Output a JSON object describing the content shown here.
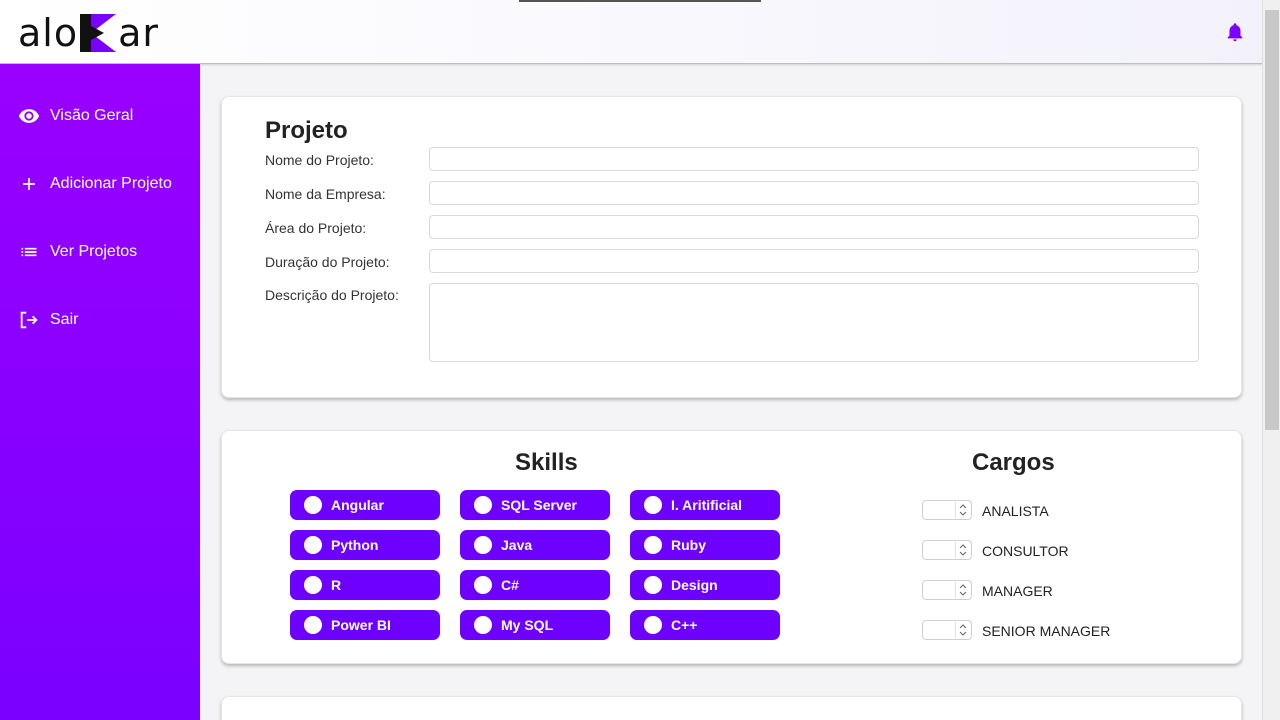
{
  "brand": {
    "logo_text_left": "alo",
    "logo_text_right": "ar"
  },
  "sidebar": {
    "items": [
      {
        "label": "Visão Geral",
        "icon": "eye-icon"
      },
      {
        "label": "Adicionar Projeto",
        "icon": "plus-icon"
      },
      {
        "label": "Ver Projetos",
        "icon": "list-icon"
      },
      {
        "label": "Sair",
        "icon": "logout-icon"
      }
    ]
  },
  "projeto": {
    "title": "Projeto",
    "fields": [
      {
        "label": "Nome do Projeto:",
        "value": ""
      },
      {
        "label": "Nome da Empresa:",
        "value": ""
      },
      {
        "label": "Área do Projeto:",
        "value": ""
      },
      {
        "label": "Duração do Projeto:",
        "value": ""
      },
      {
        "label": "Descrição do Projeto:",
        "value": ""
      }
    ]
  },
  "skills": {
    "title": "Skills",
    "items": [
      "Angular",
      "SQL Server",
      "I. Aritificial",
      "Python",
      "Java",
      "Ruby",
      "R",
      "C#",
      "Design",
      "Power BI",
      "My SQL",
      "C++"
    ]
  },
  "cargos": {
    "title": "Cargos",
    "items": [
      "ANALISTA",
      "CONSULTOR",
      "MANAGER",
      "SENIOR MANAGER"
    ]
  },
  "colors": {
    "sidebar_top": "#9900ff",
    "sidebar_bottom": "#7a00ff",
    "chip": "#6e00ff",
    "bell": "#7a00ff",
    "logo_k": "#7a00ff"
  }
}
